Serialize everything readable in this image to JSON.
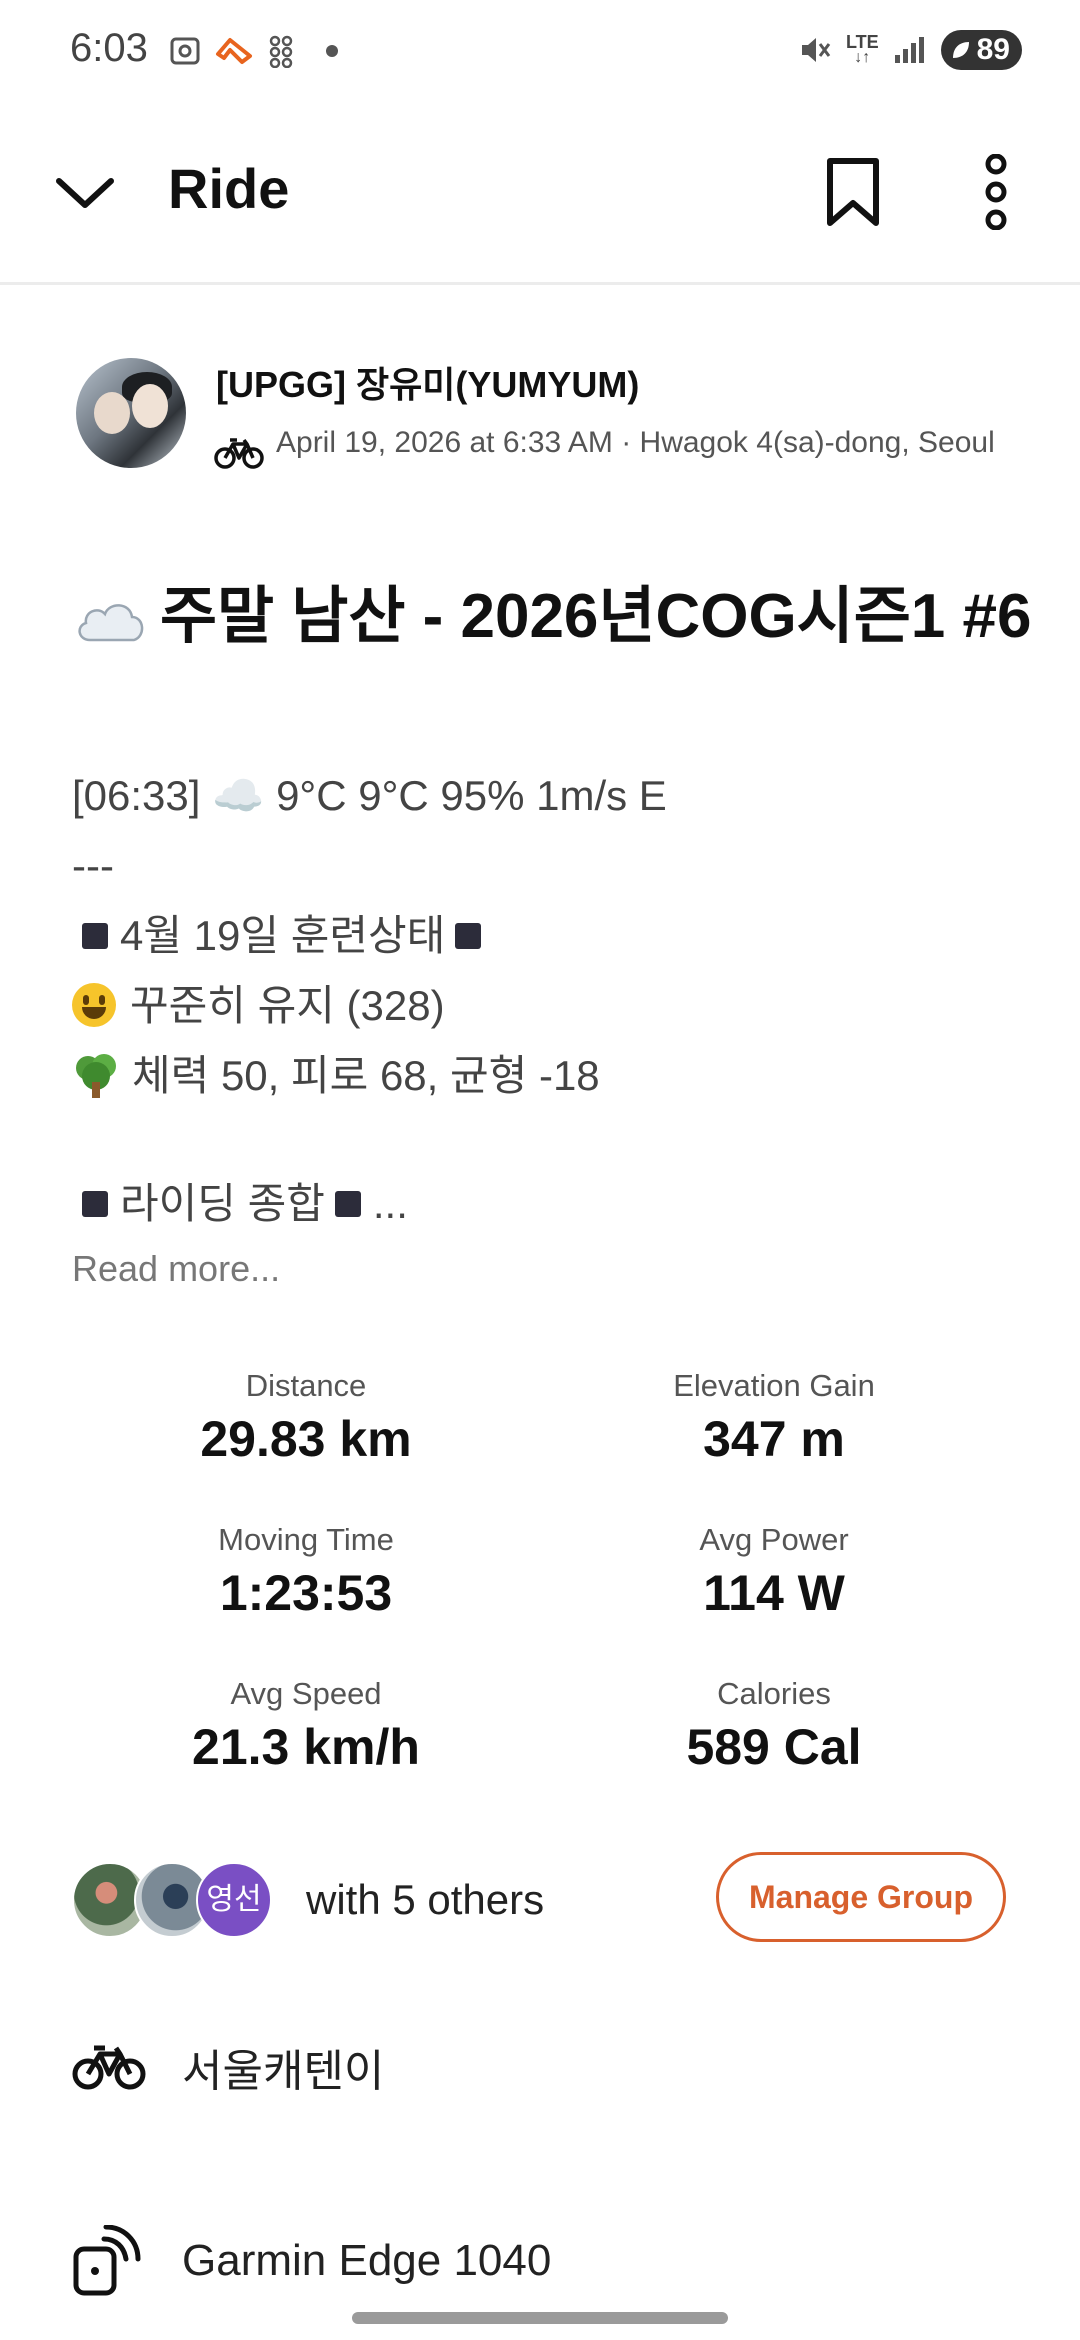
{
  "status_bar": {
    "time": "6:03",
    "network": "LTE",
    "battery": "89"
  },
  "app_bar": {
    "title": "Ride"
  },
  "athlete": {
    "name": "[UPGG] 장유미(YUMYUM)",
    "meta": "April 19, 2026 at 6:33 AM · Hwagok 4(sa)-dong, Seoul"
  },
  "activity": {
    "title": "주말 남산 - 2026년COG시즌1 #6",
    "description": {
      "weather": "[06:33] ☁️ 9°C 9°C 95% 1m/s  E",
      "separator": "---",
      "training_header": "4월 19일 훈련상태",
      "status": "꾸준히 유지 (328)",
      "fitness": "체력 50, 피로 68, 균형 -18",
      "riding_header": "라이딩 종합",
      "ellipsis": "...",
      "read_more": "Read more..."
    }
  },
  "stats": [
    {
      "label": "Distance",
      "value": "29.83 km"
    },
    {
      "label": "Elevation Gain",
      "value": "347 m"
    },
    {
      "label": "Moving Time",
      "value": "1:23:53"
    },
    {
      "label": "Avg Power",
      "value": "114 W"
    },
    {
      "label": "Avg Speed",
      "value": "21.3 km/h"
    },
    {
      "label": "Calories",
      "value": "589 Cal"
    }
  ],
  "group": {
    "avatar_initials": "영선",
    "with_others": "with 5 others",
    "manage_label": "Manage Group"
  },
  "gear": {
    "bike": "서울캐텐이",
    "device": "Garmin Edge 1040"
  },
  "colors": {
    "accent": "#d8602d",
    "text": "#111111",
    "muted": "#555555"
  }
}
